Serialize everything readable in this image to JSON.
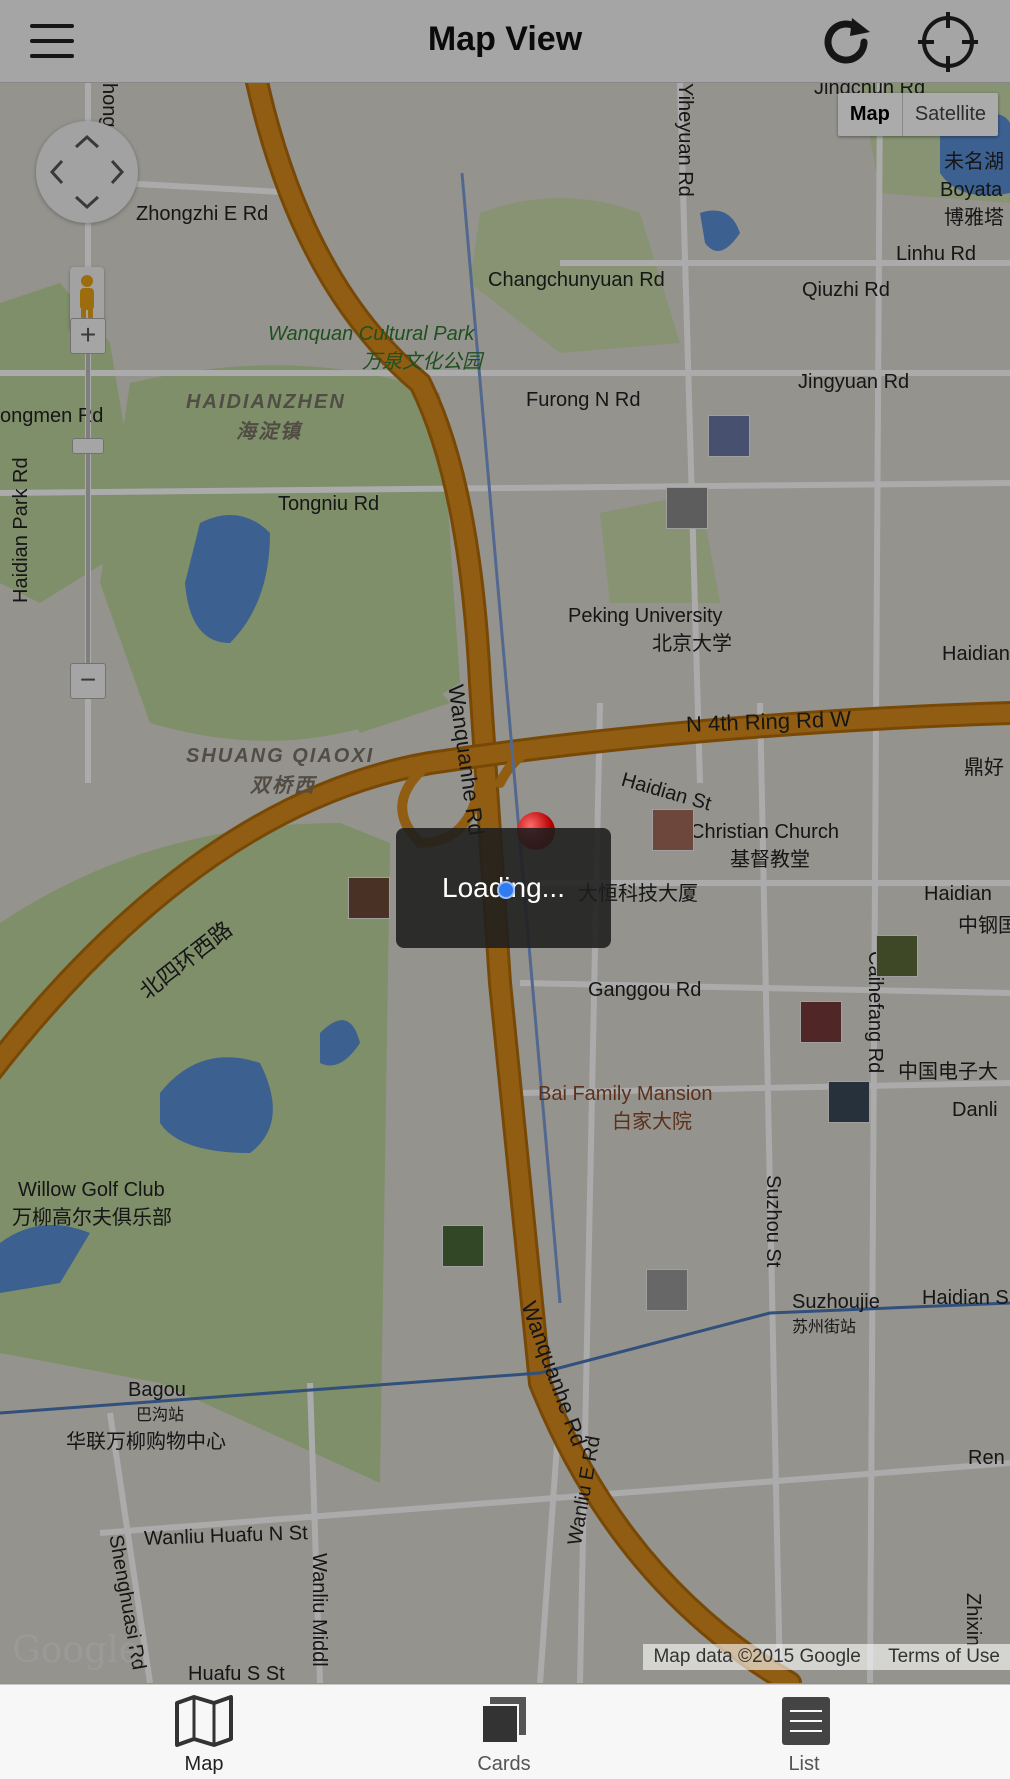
{
  "header": {
    "title": "Map View"
  },
  "map_type": {
    "map_label": "Map",
    "satellite_label": "Satellite",
    "selected": "Map"
  },
  "zoom": {
    "in_label": "+",
    "out_label": "−"
  },
  "map_labels": {
    "zhongzhi": "Zhongzhi E Rd",
    "changchunyuan": "Changchunyuan Rd",
    "qiuzhi": "Qiuzhi Rd",
    "linhu": "Linhu Rd",
    "boyata_en": "Boyata",
    "boyata_zh": "博雅塔",
    "weiming_zh": "未名湖",
    "wanquan_en": "Wanquan Cultural Park",
    "wanquan_zh": "万泉文化公园",
    "haidianzhen_en": "HAIDIANZHEN",
    "haidianzhen_zh": "海淀镇",
    "furong": "Furong N Rd",
    "jingyuan": "Jingyuan Rd",
    "yongmen": "ongmen Rd",
    "tongniu": "Tongniu Rd",
    "pku_en": "Peking University",
    "pku_zh": "北京大学",
    "haidian_right": "Haidian",
    "haidian_park": "Haidian Park Rd",
    "n4th": "N 4th Ring Rd W",
    "n4th_zh": "北四环西路",
    "shuangqiaoxi_en": "SHUANG QIAOXI",
    "shuangqiaoxi_zh": "双桥西",
    "wanquanhe1": "Wanquanhe Rd",
    "wanquanhe2": "Wanquanhe Rd",
    "haidian_st": "Haidian St",
    "church_en": "Christian Church",
    "church_zh": "基督教堂",
    "dahengkeji": "大恒科技大厦",
    "haidian2": "Haidian",
    "zhonggang": "中钢国",
    "dinghao": "鼎好",
    "ganggou": "Ganggou Rd",
    "caihefang": "Caihefang Rd",
    "zhongguodianzi": "中国电子大",
    "danli": "Danli",
    "bai_en": "Bai Family Mansion",
    "bai_zh": "白家大院",
    "suzhou_st": "Suzhou St",
    "willow_en": "Willow Golf Club",
    "willow_zh": "万柳高尔夫俱乐部",
    "suzhoujie_en": "Suzhoujie",
    "suzhoujie_zh": "苏州街站",
    "haidian_s": "Haidian S",
    "bagou_en": "Bagou",
    "bagou_zh": "巴沟站",
    "hualian": "华联万柳购物中心",
    "wanliu_huafu_n": "Wanliu Huafu N St",
    "wanliu_huafu_s": "Huafu S St",
    "shenghuasi": "Shenghuasi Rd",
    "wanliu_middle": "Wanliu Middl",
    "wanliu_e": "Wanliu E Rd",
    "ren": "Ren",
    "zhixin": "Zhixin",
    "yiheyuan": "Yiheyuan Rd",
    "jingchun": "Jingchun Rd",
    "hong": "hong"
  },
  "attribution": {
    "map_data": "Map data ©2015 Google",
    "terms": "Terms of Use"
  },
  "google_logo": "Google",
  "loading": {
    "text": "Loading..."
  },
  "tabs": [
    {
      "label": "Map",
      "icon": "map-icon",
      "active": true
    },
    {
      "label": "Cards",
      "icon": "cards-icon",
      "active": false
    },
    {
      "label": "List",
      "icon": "list-icon",
      "active": false
    }
  ],
  "colors": {
    "highway": "#d78b1b",
    "highway_edge": "#b46e0a",
    "park": "#bcd59d",
    "water": "#5a8fd6",
    "road": "#ffffff",
    "land": "#dedbd3",
    "loading_bg": "#1e1e1e",
    "location_dot": "#2f7cf0",
    "pin": "#cc0000"
  }
}
